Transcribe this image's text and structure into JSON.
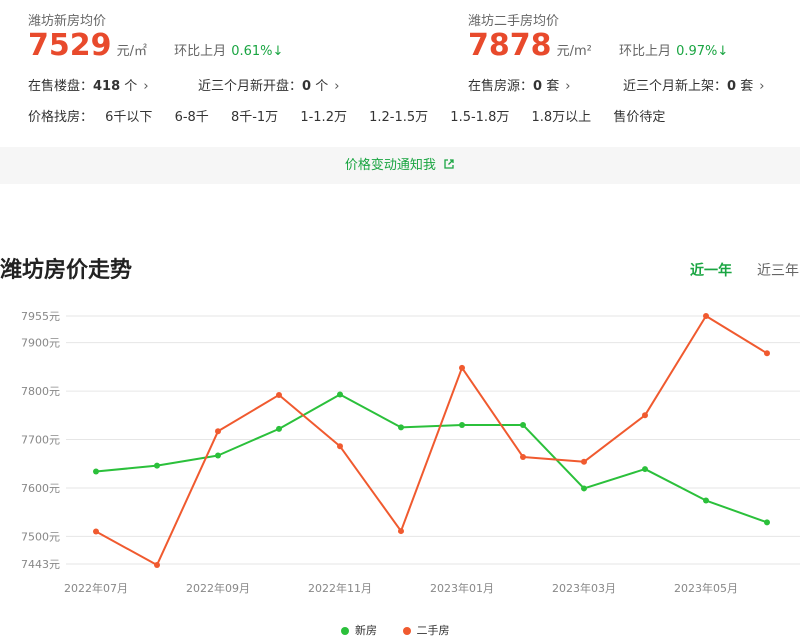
{
  "summary": {
    "new": {
      "title": "潍坊新房均价",
      "price": "7529",
      "unit": "元/㎡",
      "mom_label": "环比上月",
      "mom_value": "0.61%↓",
      "stat1_label": "在售楼盘：",
      "stat1_value": "418",
      "stat1_suffix": "个",
      "stat2_label": "近三个月新开盘：",
      "stat2_value": "0",
      "stat2_suffix": "个"
    },
    "second": {
      "title": "潍坊二手房均价",
      "price": "7878",
      "unit": "元/m²",
      "mom_label": "环比上月",
      "mom_value": "0.97%↓",
      "stat1_label": "在售房源：",
      "stat1_value": "0",
      "stat1_suffix": "套",
      "stat2_label": "近三个月新上架：",
      "stat2_value": "0",
      "stat2_suffix": "套"
    },
    "price_filter": {
      "label": "价格找房：",
      "options": [
        "6千以下",
        "6-8千",
        "8千-1万",
        "1-1.2万",
        "1.2-1.5万",
        "1.5-1.8万",
        "1.8万以上",
        "售价待定"
      ]
    },
    "notify": "价格变动通知我"
  },
  "trend": {
    "title": "潍坊房价走势",
    "tabs": [
      "近一年",
      "近三年"
    ],
    "active_tab": 0
  },
  "colors": {
    "green": "#1aa542",
    "red": "#e84a2c",
    "new_series": "#2bc03b",
    "second_series": "#f05a2f"
  },
  "chart_data": {
    "type": "line",
    "title": "潍坊房价走势",
    "x": [
      "2022-07",
      "2022-08",
      "2022-09",
      "2022-10",
      "2022-11",
      "2022-12",
      "2023-01",
      "2023-02",
      "2023-03",
      "2023-04",
      "2023-05",
      "2023-06"
    ],
    "x_tick_labels": [
      "2022年07月",
      "2022年09月",
      "2022年11月",
      "2023年01月",
      "2023年03月",
      "2023年05月"
    ],
    "y_ticks": [
      7443,
      7500,
      7600,
      7700,
      7800,
      7900,
      7955
    ],
    "y_tick_labels": [
      "7443元",
      "7500元",
      "7600元",
      "7700元",
      "7800元",
      "7900元",
      "7955元"
    ],
    "ylim": [
      7443,
      7955
    ],
    "grid": true,
    "legend": "bottom",
    "series": [
      {
        "name": "新房",
        "values": [
          7634,
          7646,
          7667,
          7722,
          7793,
          7725,
          7730,
          7730,
          7599,
          7639,
          7574,
          7529
        ]
      },
      {
        "name": "二手房",
        "values": [
          7510,
          7441,
          7717,
          7792,
          7686,
          7511,
          7848,
          7664,
          7654,
          7750,
          7955,
          7878
        ]
      }
    ]
  }
}
